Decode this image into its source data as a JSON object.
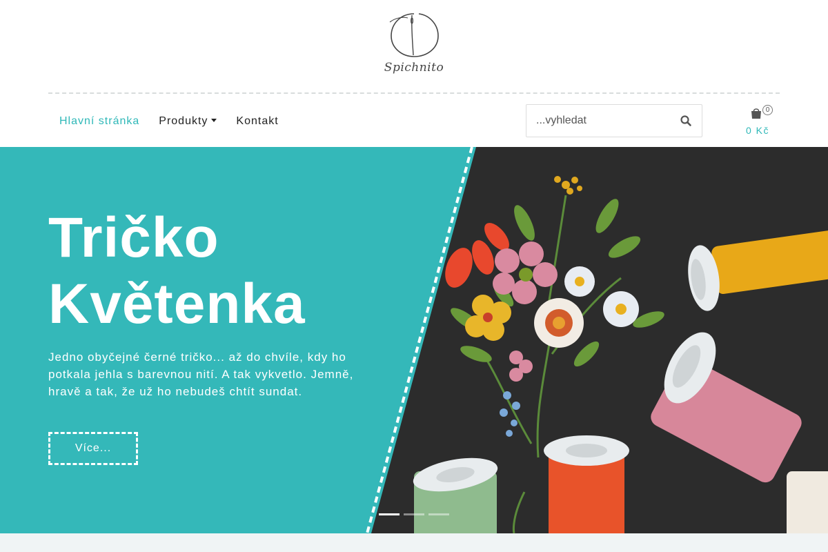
{
  "logo": {
    "text": "Spichnito"
  },
  "nav": {
    "items": [
      {
        "label": "Hlavní stránka",
        "active": true
      },
      {
        "label": "Produkty",
        "dropdown": true
      },
      {
        "label": "Kontakt"
      }
    ]
  },
  "search": {
    "placeholder": "...vyhledat",
    "icon": "search-icon"
  },
  "cart": {
    "count": "0",
    "total": "0 Kč",
    "icon": "shopping-bag-icon"
  },
  "hero": {
    "title": "Tričko Květenka",
    "description": "Jedno obyčejné černé tričko... až do chvíle, kdy ho potkala jehla s barevnou nití. A tak vykvetlo. Jemně, hravě a tak, že už ho nebudeš chtít sundat.",
    "button_label": "Více...",
    "slides_count": 3,
    "active_slide": 1
  },
  "colors": {
    "accent": "#2fb8b8",
    "hero_bg": "#34b8b9",
    "text": "#222222"
  }
}
